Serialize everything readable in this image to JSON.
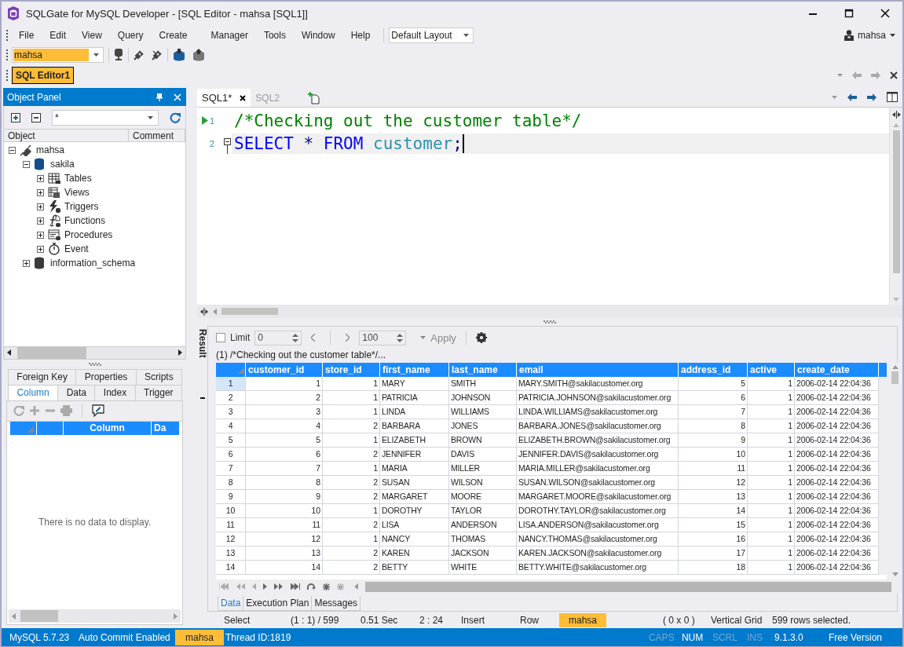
{
  "window": {
    "title": "SQLGate for MySQL Developer - [SQL Editor - mahsa [SQL1]]"
  },
  "menu": [
    "File",
    "Edit",
    "View",
    "Query",
    "Create",
    "Manager",
    "Tools",
    "Window",
    "Help"
  ],
  "layout_select": {
    "value": "Default Layout"
  },
  "user": {
    "name": "mahsa"
  },
  "connection_select": {
    "value": "mahsa"
  },
  "documents": [
    {
      "label": "SQL Editor1",
      "selected": true
    }
  ],
  "object_panel": {
    "title": "Object Panel",
    "filter": {
      "value": "*"
    },
    "columns": [
      "Object",
      "Comment"
    ],
    "tree": [
      {
        "label": "mahsa",
        "kind": "connection",
        "expanded": true,
        "children": [
          {
            "label": "sakila",
            "kind": "database",
            "active": true,
            "expanded": true,
            "children": [
              {
                "label": "Tables",
                "kind": "tables",
                "expanded": false
              },
              {
                "label": "Views",
                "kind": "views",
                "expanded": false
              },
              {
                "label": "Triggers",
                "kind": "triggers",
                "expanded": false
              },
              {
                "label": "Functions",
                "kind": "functions",
                "expanded": false
              },
              {
                "label": "Procedures",
                "kind": "procedures",
                "expanded": false
              },
              {
                "label": "Event",
                "kind": "event",
                "expanded": false
              }
            ]
          },
          {
            "label": "information_schema",
            "kind": "database",
            "active": false,
            "expanded": false
          }
        ]
      }
    ]
  },
  "properties_panel": {
    "tabs_top": [
      {
        "label": "Foreign Key",
        "selected": false
      },
      {
        "label": "Properties",
        "selected": false
      },
      {
        "label": "Scripts",
        "selected": false
      }
    ],
    "tabs_bottom": [
      {
        "label": "Column",
        "selected": true
      },
      {
        "label": "Data",
        "selected": false
      },
      {
        "label": "Index",
        "selected": false
      },
      {
        "label": "Trigger",
        "selected": false
      }
    ],
    "grid_columns": [
      "Column",
      "Da"
    ],
    "empty_message": "There is no data to display."
  },
  "editor": {
    "tabs": [
      {
        "label": "SQL1*",
        "selected": true
      },
      {
        "label": "SQL2",
        "selected": false
      }
    ],
    "lines": [
      {
        "number": "1",
        "running": true,
        "current": false,
        "tokens": [
          {
            "text": "/*Checking out the customer table*/",
            "kind": "comment"
          }
        ]
      },
      {
        "number": "2",
        "running": false,
        "current": true,
        "tokens": [
          {
            "text": "SELECT",
            "kind": "keyword"
          },
          {
            "text": " * ",
            "kind": "operator"
          },
          {
            "text": "FROM",
            "kind": "keyword"
          },
          {
            "text": " customer",
            "kind": "identifier"
          },
          {
            "text": ";",
            "kind": "punctuation"
          }
        ]
      }
    ]
  },
  "result": {
    "side_label": "Result",
    "limit": {
      "label": "Limit",
      "checked": false,
      "value": "0"
    },
    "page_size": {
      "value": "100"
    },
    "apply": {
      "label": "Apply",
      "disabled": true
    },
    "caption": "(1) /*Checking out the customer table*/...",
    "columns": [
      {
        "label": "customer_id",
        "numeric": true
      },
      {
        "label": "store_id",
        "numeric": true
      },
      {
        "label": "first_name",
        "numeric": false
      },
      {
        "label": "last_name",
        "numeric": false
      },
      {
        "label": "email",
        "numeric": false
      },
      {
        "label": "address_id",
        "numeric": true
      },
      {
        "label": "active",
        "numeric": true
      },
      {
        "label": "create_date",
        "numeric": false
      }
    ],
    "rows": [
      {
        "number": "1",
        "selected": true,
        "cells": [
          "1",
          "1",
          "MARY",
          "SMITH",
          "MARY.SMITH@sakilacustomer.org",
          "5",
          "1",
          "2006-02-14 22:04:36"
        ]
      },
      {
        "number": "2",
        "selected": false,
        "cells": [
          "2",
          "1",
          "PATRICIA",
          "JOHNSON",
          "PATRICIA.JOHNSON@sakilacustomer.org",
          "6",
          "1",
          "2006-02-14 22:04:36"
        ]
      },
      {
        "number": "3",
        "selected": false,
        "cells": [
          "3",
          "1",
          "LINDA",
          "WILLIAMS",
          "LINDA.WILLIAMS@sakilacustomer.org",
          "7",
          "1",
          "2006-02-14 22:04:36"
        ]
      },
      {
        "number": "4",
        "selected": false,
        "cells": [
          "4",
          "2",
          "BARBARA",
          "JONES",
          "BARBARA.JONES@sakilacustomer.org",
          "8",
          "1",
          "2006-02-14 22:04:36"
        ]
      },
      {
        "number": "5",
        "selected": false,
        "cells": [
          "5",
          "1",
          "ELIZABETH",
          "BROWN",
          "ELIZABETH.BROWN@sakilacustomer.org",
          "9",
          "1",
          "2006-02-14 22:04:36"
        ]
      },
      {
        "number": "6",
        "selected": false,
        "cells": [
          "6",
          "2",
          "JENNIFER",
          "DAVIS",
          "JENNIFER.DAVIS@sakilacustomer.org",
          "10",
          "1",
          "2006-02-14 22:04:36"
        ]
      },
      {
        "number": "7",
        "selected": false,
        "cells": [
          "7",
          "1",
          "MARIA",
          "MILLER",
          "MARIA.MILLER@sakilacustomer.org",
          "11",
          "1",
          "2006-02-14 22:04:36"
        ]
      },
      {
        "number": "8",
        "selected": false,
        "cells": [
          "8",
          "2",
          "SUSAN",
          "WILSON",
          "SUSAN.WILSON@sakilacustomer.org",
          "12",
          "1",
          "2006-02-14 22:04:36"
        ]
      },
      {
        "number": "9",
        "selected": false,
        "cells": [
          "9",
          "2",
          "MARGARET",
          "MOORE",
          "MARGARET.MOORE@sakilacustomer.org",
          "13",
          "1",
          "2006-02-14 22:04:36"
        ]
      },
      {
        "number": "10",
        "selected": false,
        "cells": [
          "10",
          "1",
          "DOROTHY",
          "TAYLOR",
          "DOROTHY.TAYLOR@sakilacustomer.org",
          "14",
          "1",
          "2006-02-14 22:04:36"
        ]
      },
      {
        "number": "11",
        "selected": false,
        "cells": [
          "11",
          "2",
          "LISA",
          "ANDERSON",
          "LISA.ANDERSON@sakilacustomer.org",
          "15",
          "1",
          "2006-02-14 22:04:36"
        ]
      },
      {
        "number": "12",
        "selected": false,
        "cells": [
          "12",
          "1",
          "NANCY",
          "THOMAS",
          "NANCY.THOMAS@sakilacustomer.org",
          "16",
          "1",
          "2006-02-14 22:04:36"
        ]
      },
      {
        "number": "13",
        "selected": false,
        "cells": [
          "13",
          "2",
          "KAREN",
          "JACKSON",
          "KAREN.JACKSON@sakilacustomer.org",
          "17",
          "1",
          "2006-02-14 22:04:36"
        ]
      },
      {
        "number": "14",
        "selected": false,
        "cells": [
          "14",
          "2",
          "BETTY",
          "WHITE",
          "BETTY.WHITE@sakilacustomer.org",
          "18",
          "1",
          "2006-02-14 22:04:36"
        ]
      }
    ],
    "bottom_tabs": [
      {
        "label": "Data",
        "selected": true
      },
      {
        "label": "Execution Plan",
        "selected": false
      },
      {
        "label": "Messages",
        "selected": false
      }
    ]
  },
  "editor_status": [
    {
      "text": "Select",
      "highlighted": false
    },
    {
      "text": "(1 : 1) / 599",
      "highlighted": false
    },
    {
      "text": "0.51 Sec",
      "highlighted": false
    },
    {
      "text": "2 : 24",
      "highlighted": false
    },
    {
      "text": "Insert",
      "highlighted": false
    },
    {
      "text": "Row",
      "highlighted": false
    },
    {
      "text": "mahsa",
      "highlighted": true
    },
    {
      "text": "( 0 x 0 )",
      "highlighted": false
    },
    {
      "text": "Vertical Grid",
      "highlighted": false
    },
    {
      "text": "599 rows selected.",
      "highlighted": false
    }
  ],
  "status_bar": {
    "left": [
      {
        "text": "MySQL 5.7.23",
        "highlighted": false
      },
      {
        "text": "Auto Commit Enabled",
        "highlighted": false
      },
      {
        "text": "mahsa",
        "highlighted": true
      },
      {
        "text": "Thread ID:1819",
        "highlighted": false
      }
    ],
    "right": [
      {
        "text": "CAPS",
        "enabled": false
      },
      {
        "text": "NUM",
        "enabled": true
      },
      {
        "text": "SCRL",
        "enabled": false
      },
      {
        "text": "INS",
        "enabled": false
      },
      {
        "text": "9.1.3.0",
        "enabled": true
      },
      {
        "text": "Free Version",
        "enabled": true
      }
    ]
  }
}
